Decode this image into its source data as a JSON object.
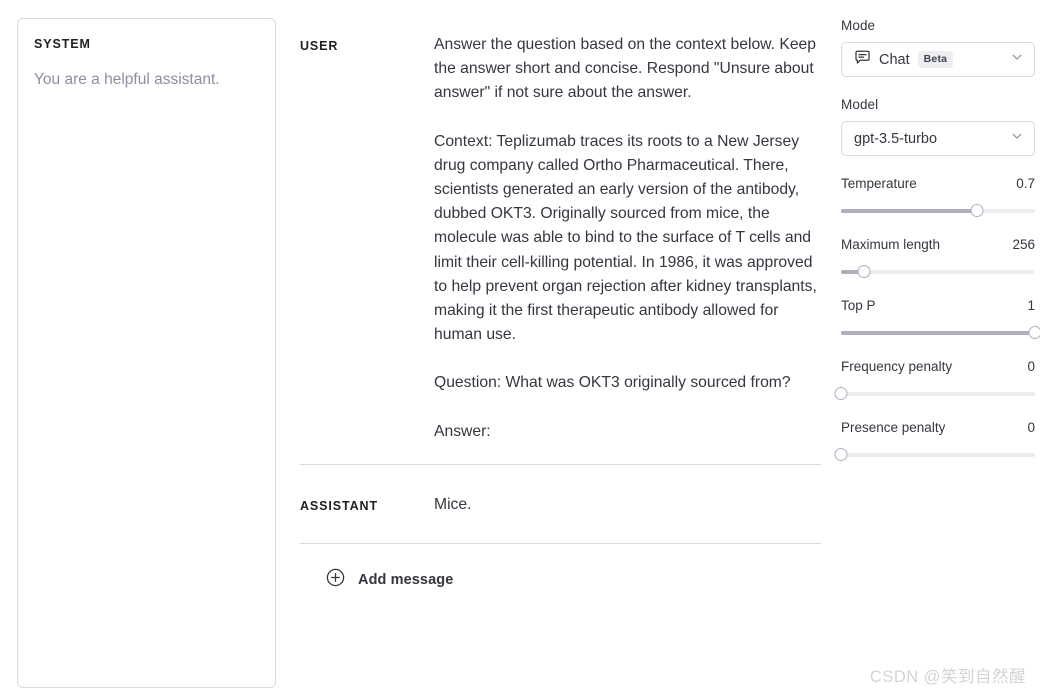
{
  "system": {
    "label": "SYSTEM",
    "text": "You are a helpful assistant."
  },
  "conversation": {
    "messages": [
      {
        "role_label": "USER",
        "text": "Answer the question based on the context below. Keep the answer short and concise. Respond \"Unsure about answer\" if not sure about the answer.\n\nContext: Teplizumab traces its roots to a New Jersey drug company called Ortho Pharmaceutical. There, scientists generated an early version of the antibody, dubbed OKT3. Originally sourced from mice, the molecule was able to bind to the surface of T cells and limit their cell-killing potential. In 1986, it was approved to help prevent organ rejection after kidney transplants, making it the first therapeutic antibody allowed for human use.\n\nQuestion: What was OKT3 originally sourced from?\n\nAnswer:"
      },
      {
        "role_label": "ASSISTANT",
        "text": "Mice."
      }
    ],
    "add_message_label": "Add message",
    "add_message_icon": "plus-circle-icon"
  },
  "sidebar": {
    "mode": {
      "label": "Mode",
      "value": "Chat",
      "badge": "Beta",
      "icon": "chat-bubble-icon",
      "chevron_icon": "chevron-down-icon"
    },
    "model": {
      "label": "Model",
      "value": "gpt-3.5-turbo",
      "chevron_icon": "chevron-down-icon"
    },
    "sliders": [
      {
        "name": "Temperature",
        "value": "0.7",
        "percent": 70
      },
      {
        "name": "Maximum length",
        "value": "256",
        "percent": 12
      },
      {
        "name": "Top P",
        "value": "1",
        "percent": 100
      },
      {
        "name": "Frequency penalty",
        "value": "0",
        "percent": 0
      },
      {
        "name": "Presence penalty",
        "value": "0",
        "percent": 0
      }
    ]
  },
  "watermark": {
    "text": "CSDN @笑到自然醒"
  },
  "colors": {
    "border": "#d9d9e3",
    "text": "#353740",
    "muted": "#8e8ea0",
    "track": "#ececf1",
    "track_fill": "#aeaec0"
  }
}
